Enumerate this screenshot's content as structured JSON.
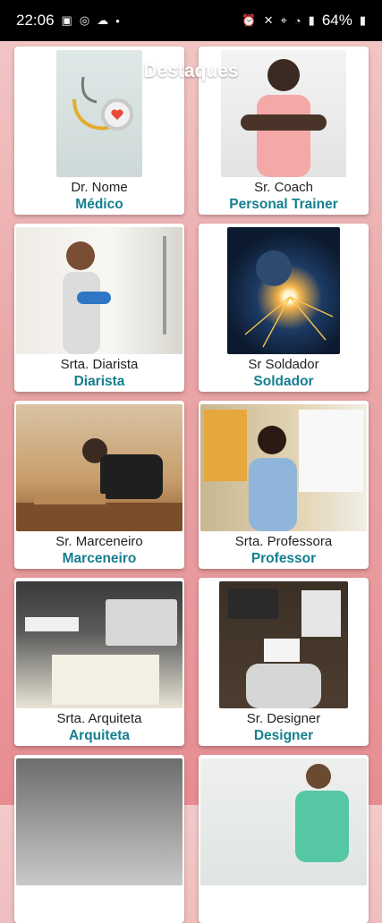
{
  "status_bar": {
    "time": "22:06",
    "left_icons": [
      "gallery-icon",
      "whatsapp-icon",
      "notification-icon",
      "dot-icon"
    ],
    "right_icons": [
      "alarm-icon",
      "mute-icon",
      "location-icon",
      "wifi-icon",
      "signal-icon"
    ],
    "battery": "64%"
  },
  "app_bar": {
    "title": "Destaques",
    "menu_icon": "hamburger-menu-icon"
  },
  "cards": [
    {
      "name": "Dr. Nome",
      "role": "Médico",
      "image": "stethoscope-photo"
    },
    {
      "name": "Sr. Coach",
      "role": "Personal Trainer",
      "image": "coach-photo"
    },
    {
      "name": "Srta. Diarista",
      "role": "Diarista",
      "image": "cleaner-photo"
    },
    {
      "name": "Sr Soldador",
      "role": "Soldador",
      "image": "welder-photo"
    },
    {
      "name": "Sr. Marceneiro",
      "role": "Marceneiro",
      "image": "carpenter-photo"
    },
    {
      "name": "Srta. Professora",
      "role": "Professor",
      "image": "teacher-photo"
    },
    {
      "name": "Srta. Arquiteta",
      "role": "Arquiteta",
      "image": "architect-photo"
    },
    {
      "name": "Sr. Designer",
      "role": "Designer",
      "image": "designer-photo"
    },
    {
      "name": "",
      "role": "",
      "image": "partial-photo-left"
    },
    {
      "name": "",
      "role": "",
      "image": "partial-photo-right"
    }
  ],
  "colors": {
    "role_text": "#157f8f",
    "background_top": "#f3c9c9",
    "background_bottom": "#e78d92"
  }
}
